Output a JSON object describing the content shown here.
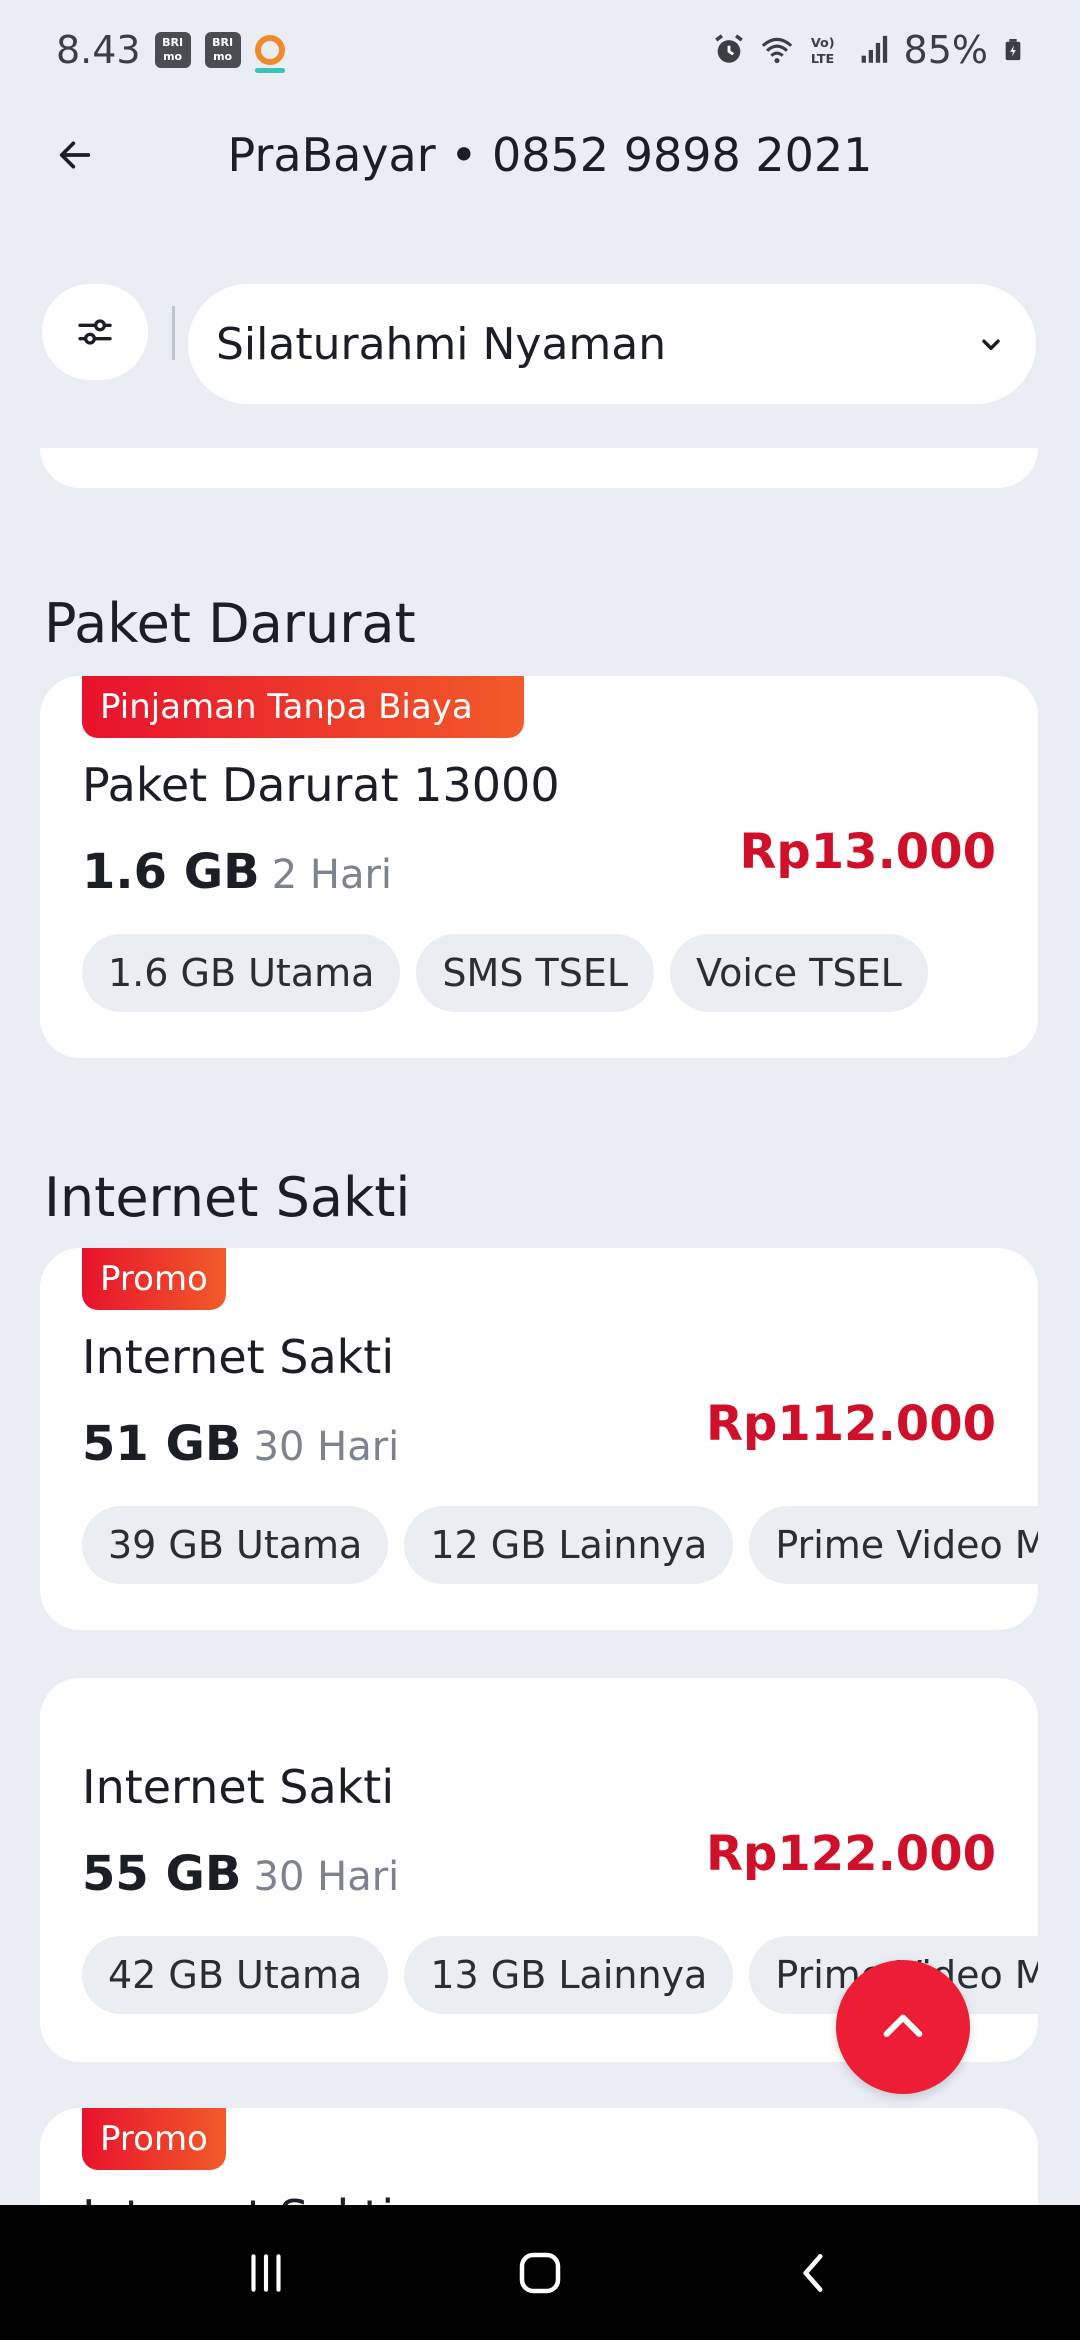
{
  "status_bar": {
    "time": "8.43",
    "app_badge_1": "BRI mo",
    "app_badge_2": "BRI mo",
    "battery": "85%",
    "icons": [
      "alarm-icon",
      "wifi-icon",
      "volte-icon",
      "signal-icon",
      "battery-icon"
    ]
  },
  "header": {
    "title": "PraBayar • 0852 9898 2021",
    "back_icon": "arrow-left-icon"
  },
  "filter": {
    "icon": "sliders-icon",
    "selected_category": "Silaturahmi Nyaman"
  },
  "sections": [
    {
      "title": "Paket Darurat",
      "cards": [
        {
          "badge": "Pinjaman Tanpa Biaya",
          "name": "Paket Darurat 13000",
          "quota": "1.6 GB",
          "duration": "2 Hari",
          "price": "Rp13.000",
          "chips": [
            "1.6 GB Utama",
            "SMS TSEL",
            "Voice TSEL"
          ]
        }
      ]
    },
    {
      "title": "Internet Sakti",
      "cards": [
        {
          "badge": "Promo",
          "name": "Internet Sakti",
          "quota": "51 GB",
          "duration": "30 Hari",
          "price": "Rp112.000",
          "chips": [
            "39 GB Utama",
            "12 GB Lainnya",
            "Prime Video Mobile"
          ]
        },
        {
          "badge": "",
          "name": "Internet Sakti",
          "quota": "55 GB",
          "duration": "30 Hari",
          "price": "Rp122.000",
          "chips": [
            "42 GB Utama",
            "13 GB Lainnya",
            "Prime Video Mobile"
          ]
        },
        {
          "badge": "Promo",
          "name": "Internet Sakti"
        }
      ]
    }
  ],
  "colors": {
    "background": "#eaeef4",
    "price": "#d0102b",
    "badge_start": "#e8122c",
    "badge_end": "#f25b2a",
    "fab": "#ee1d36"
  }
}
